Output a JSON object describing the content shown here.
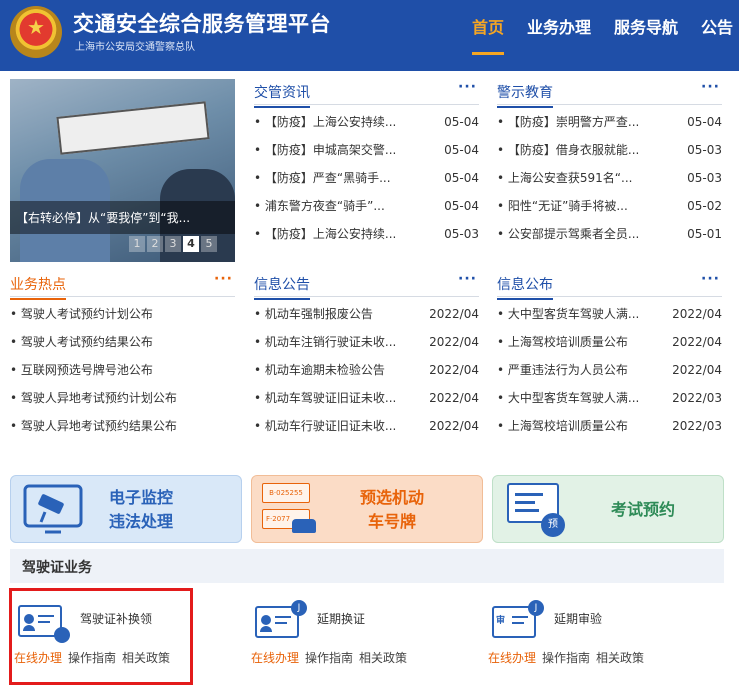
{
  "header": {
    "title": "交通安全综合服务管理平台",
    "subtitle": "上海市公安局交通警察总队",
    "nav": [
      "首页",
      "业务办理",
      "服务导航",
      "公告"
    ]
  },
  "carousel": {
    "caption": "【右转必停】从“要我停”到“我...",
    "dots": [
      "1",
      "2",
      "3",
      "4",
      "5"
    ],
    "active_dot": 4
  },
  "panels": {
    "jiaoguan": {
      "title": "交管资讯",
      "more": "···",
      "items": [
        {
          "text": "• 【防疫】上海公安持续...",
          "date": "05-04"
        },
        {
          "text": "• 【防疫】申城高架交警...",
          "date": "05-04"
        },
        {
          "text": "• 【防疫】严查“黑骑手...",
          "date": "05-04"
        },
        {
          "text": "• 浦东警方夜查“骑手”...",
          "date": "05-04"
        },
        {
          "text": "• 【防疫】上海公安持续...",
          "date": "05-03"
        }
      ]
    },
    "jingshi": {
      "title": "警示教育",
      "more": "···",
      "items": [
        {
          "text": "• 【防疫】崇明警方严查...",
          "date": "05-04"
        },
        {
          "text": "• 【防疫】借身衣服就能...",
          "date": "05-03"
        },
        {
          "text": "• 上海公安查获591名“...",
          "date": "05-03"
        },
        {
          "text": "• 阳性“无证”骑手将被...",
          "date": "05-02"
        },
        {
          "text": "• 公安部提示驾乘者全员...",
          "date": "05-01"
        }
      ]
    },
    "redian": {
      "title": "业务热点",
      "more": "···",
      "items": [
        {
          "text": "• 驾驶人考试预约计划公布",
          "date": ""
        },
        {
          "text": "• 驾驶人考试预约结果公布",
          "date": ""
        },
        {
          "text": "• 互联网预选号牌号池公布",
          "date": ""
        },
        {
          "text": "• 驾驶人异地考试预约计划公布",
          "date": ""
        },
        {
          "text": "• 驾驶人异地考试预约结果公布",
          "date": ""
        }
      ]
    },
    "gonggao": {
      "title": "信息公告",
      "more": "···",
      "items": [
        {
          "text": "• 机动车强制报废公告",
          "date": "2022/04"
        },
        {
          "text": "• 机动车注销行驶证未收...",
          "date": "2022/04"
        },
        {
          "text": "• 机动车逾期未检验公告",
          "date": "2022/04"
        },
        {
          "text": "• 机动车驾驶证旧证未收...",
          "date": "2022/04"
        },
        {
          "text": "• 机动车行驶证旧证未收...",
          "date": "2022/04"
        }
      ]
    },
    "gongbu": {
      "title": "信息公布",
      "more": "···",
      "items": [
        {
          "text": "• 大中型客货车驾驶人满...",
          "date": "2022/04"
        },
        {
          "text": "• 上海驾校培训质量公布",
          "date": "2022/04"
        },
        {
          "text": "• 严重违法行为人员公布",
          "date": "2022/04"
        },
        {
          "text": "• 大中型客货车驾驶人满...",
          "date": "2022/03"
        },
        {
          "text": "• 上海驾校培训质量公布",
          "date": "2022/03"
        }
      ]
    }
  },
  "tiles": {
    "monitor": {
      "line1": "电子监控",
      "line2": "违法处理"
    },
    "plate": {
      "line1": "预选机动",
      "line2": "车号牌",
      "plate_top": "B·025255",
      "plate_bottom": "F·2077"
    },
    "exam": {
      "line1": "考试预约",
      "badge": "预"
    }
  },
  "section": {
    "title": "驾驶证业务"
  },
  "services": [
    {
      "title": "驾驶证补换领",
      "links": [
        "在线办理",
        "操作指南",
        "相关政策"
      ],
      "highlighted": true
    },
    {
      "title": "延期换证",
      "links": [
        "在线办理",
        "操作指南",
        "相关政策"
      ],
      "badge": "J"
    },
    {
      "title": "延期审验",
      "links": [
        "在线办理",
        "操作指南",
        "相关政策"
      ],
      "badge": "J",
      "card_text": "审"
    }
  ],
  "colors": {
    "header_bg": "#1f4fa8",
    "accent_orange": "#e8630a",
    "nav_active": "#f5a623",
    "highlight_red": "#e31b1b"
  }
}
